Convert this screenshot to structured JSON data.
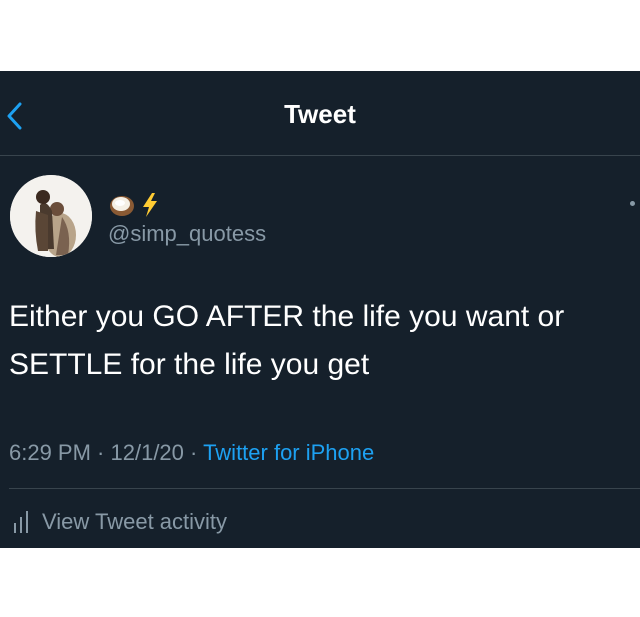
{
  "header": {
    "title": "Tweet",
    "back_icon": "chevron-left-icon"
  },
  "author": {
    "emoji_icons": [
      "coconut-icon",
      "lightning-icon"
    ],
    "handle": "@simp_quotess"
  },
  "tweet": {
    "line1": "Either you GO AFTER the life you want or",
    "line2": "SETTLE for the life you get"
  },
  "meta": {
    "time": "6:29 PM",
    "sep1": " · ",
    "date": "12/1/20",
    "sep2": " · ",
    "source": "Twitter for iPhone"
  },
  "activity": {
    "label": "View Tweet activity",
    "icon": "bar-chart-icon"
  },
  "colors": {
    "background": "#15202b",
    "accent": "#1da1f2",
    "secondary_text": "#8899a6",
    "divider": "#38444d"
  }
}
